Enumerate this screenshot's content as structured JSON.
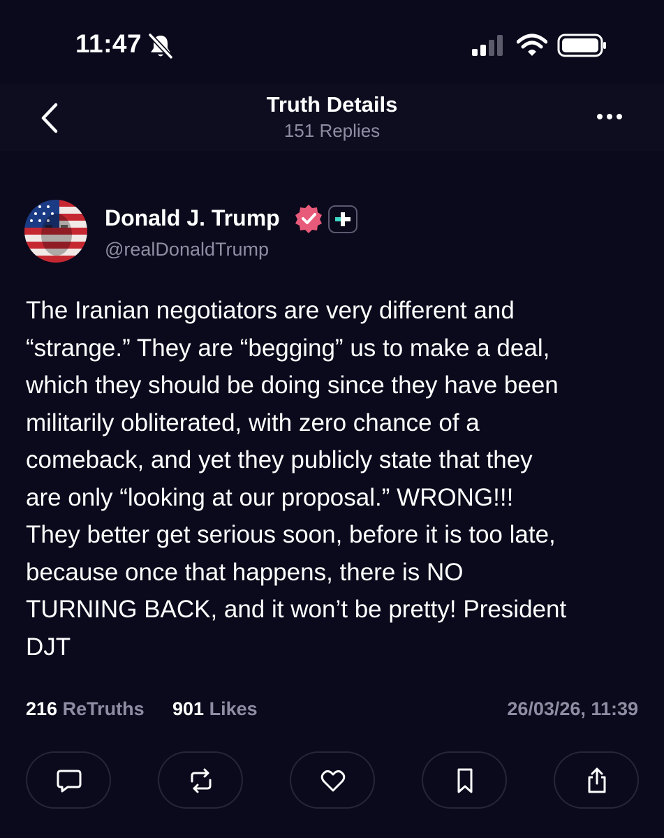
{
  "status_bar": {
    "time": "11:47",
    "icons": [
      "bell-slash-icon",
      "cellular-signal-icon",
      "wifi-icon",
      "battery-icon"
    ]
  },
  "header": {
    "title": "Truth Details",
    "subtitle": "151 Replies",
    "icons": [
      "chevron-left-icon",
      "more-horizontal-icon"
    ]
  },
  "author": {
    "name": "Donald J. Trump",
    "handle": "@realDonaldTrump",
    "verified_color": "#e85a7a",
    "icons": [
      "verified-badge-icon",
      "plus-icon"
    ]
  },
  "post": {
    "text": "The Iranian negotiators are very different and\n“strange.” They are “begging” us to make a deal,\nwhich they should be doing since they have been\nmilitarily obliterated, with zero chance of a\ncomeback, and yet they publicly state that they\nare only “looking at our proposal.” WRONG!!!\nThey better get serious soon, before it is too late,\nbecause once that happens, there is NO\nTURNING BACK, and it won’t be pretty! President\nDJT"
  },
  "stats": {
    "retruths_count": "216",
    "retruths_label": "ReTruths",
    "likes_count": "901",
    "likes_label": "Likes",
    "timestamp": "26/03/26, 11:39"
  },
  "actions": {
    "icons": [
      "reply-icon",
      "retruth-icon",
      "heart-icon",
      "bookmark-icon",
      "share-icon"
    ]
  },
  "colors": {
    "background": "#0b0a1c",
    "muted_text": "#8e8da4",
    "accent": "#e85a7a"
  }
}
